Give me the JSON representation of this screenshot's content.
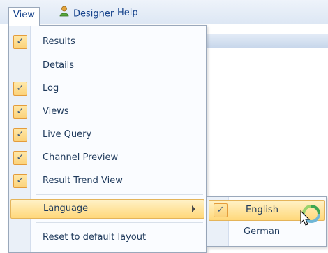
{
  "menubar": {
    "items": [
      {
        "label": "View"
      },
      {
        "label": "Designer",
        "icon": "user-icon"
      },
      {
        "label": "Help"
      }
    ]
  },
  "menu": {
    "items": [
      {
        "label": "Results",
        "checked": true
      },
      {
        "label": "Details",
        "checked": false
      },
      {
        "label": "Log",
        "checked": true
      },
      {
        "label": "Views",
        "checked": true
      },
      {
        "label": "Live Query",
        "checked": true
      },
      {
        "label": "Channel Preview",
        "checked": true
      },
      {
        "label": "Result Trend View",
        "checked": true
      },
      {
        "label": "Language",
        "submenu": true,
        "highlighted": true
      },
      {
        "label": "Reset to default layout"
      }
    ],
    "check_glyph": "✓"
  },
  "submenu": {
    "items": [
      {
        "label": "English",
        "checked": true,
        "highlighted": true
      },
      {
        "label": "German",
        "checked": false
      }
    ]
  },
  "colors": {
    "highlight": "#ffd87a",
    "check_border": "#e49c3b",
    "menu_text": "#1e395b"
  },
  "icons": [
    "user-icon",
    "checkmark-icon",
    "submenu-arrow-icon",
    "busy-spinner-icon",
    "mouse-cursor-icon"
  ]
}
